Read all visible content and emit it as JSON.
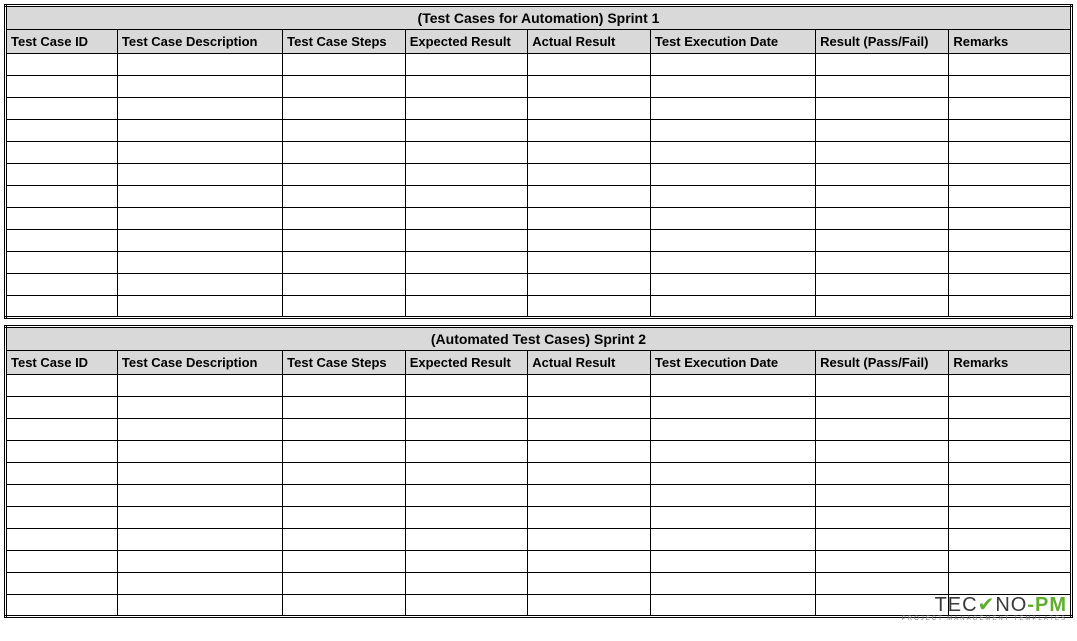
{
  "columns": [
    "Test Case ID",
    "Test Case Description",
    "Test Case Steps",
    "Expected Result",
    "Actual Result",
    "Test Execution Date",
    "Result (Pass/Fail)",
    "Remarks"
  ],
  "sections": [
    {
      "title": "(Test Cases for Automation)  Sprint 1",
      "rows": [
        [
          "",
          "",
          "",
          "",
          "",
          "",
          "",
          ""
        ],
        [
          "",
          "",
          "",
          "",
          "",
          "",
          "",
          ""
        ],
        [
          "",
          "",
          "",
          "",
          "",
          "",
          "",
          ""
        ],
        [
          "",
          "",
          "",
          "",
          "",
          "",
          "",
          ""
        ],
        [
          "",
          "",
          "",
          "",
          "",
          "",
          "",
          ""
        ],
        [
          "",
          "",
          "",
          "",
          "",
          "",
          "",
          ""
        ],
        [
          "",
          "",
          "",
          "",
          "",
          "",
          "",
          ""
        ],
        [
          "",
          "",
          "",
          "",
          "",
          "",
          "",
          ""
        ],
        [
          "",
          "",
          "",
          "",
          "",
          "",
          "",
          ""
        ],
        [
          "",
          "",
          "",
          "",
          "",
          "",
          "",
          ""
        ],
        [
          "",
          "",
          "",
          "",
          "",
          "",
          "",
          ""
        ],
        [
          "",
          "",
          "",
          "",
          "",
          "",
          "",
          ""
        ]
      ]
    },
    {
      "title": "(Automated Test Cases)  Sprint 2",
      "rows": [
        [
          "",
          "",
          "",
          "",
          "",
          "",
          "",
          ""
        ],
        [
          "",
          "",
          "",
          "",
          "",
          "",
          "",
          ""
        ],
        [
          "",
          "",
          "",
          "",
          "",
          "",
          "",
          ""
        ],
        [
          "",
          "",
          "",
          "",
          "",
          "",
          "",
          ""
        ],
        [
          "",
          "",
          "",
          "",
          "",
          "",
          "",
          ""
        ],
        [
          "",
          "",
          "",
          "",
          "",
          "",
          "",
          ""
        ],
        [
          "",
          "",
          "",
          "",
          "",
          "",
          "",
          ""
        ],
        [
          "",
          "",
          "",
          "",
          "",
          "",
          "",
          ""
        ],
        [
          "",
          "",
          "",
          "",
          "",
          "",
          "",
          ""
        ],
        [
          "",
          "",
          "",
          "",
          "",
          "",
          "",
          ""
        ],
        [
          "",
          "",
          "",
          "",
          "",
          "",
          "",
          ""
        ]
      ]
    }
  ],
  "logo": {
    "brand_left": "TEC",
    "brand_mid": "✔",
    "brand_right": "NO",
    "brand_suffix": "-PM",
    "tagline": "PROJECT MANAGEMENT TEMPLATES"
  }
}
